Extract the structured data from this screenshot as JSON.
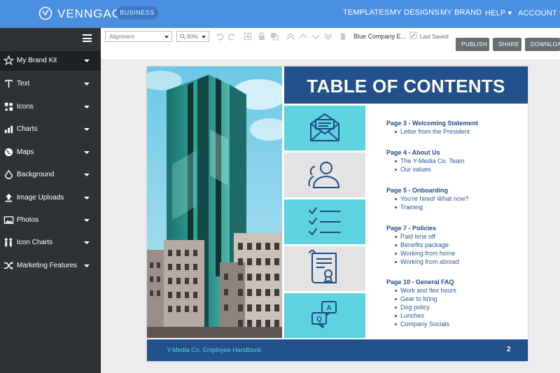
{
  "app": {
    "brand": "VENNGAGE",
    "plan_badge": "BUSINESS",
    "nav": [
      "TEMPLATES",
      "MY DESIGNS",
      "MY BRAND",
      "HELP ▾",
      "ACCOUNT ▾"
    ]
  },
  "sidebar": {
    "items": [
      {
        "label": "My Brand Kit",
        "icon": "star-icon"
      },
      {
        "label": "Text",
        "icon": "text-icon"
      },
      {
        "label": "Icons",
        "icon": "icons-grid-icon"
      },
      {
        "label": "Charts",
        "icon": "bar-chart-icon"
      },
      {
        "label": "Maps",
        "icon": "globe-icon"
      },
      {
        "label": "Background",
        "icon": "paint-bucket-icon"
      },
      {
        "label": "Image Uploads",
        "icon": "upload-icon"
      },
      {
        "label": "Photos",
        "icon": "photo-icon"
      },
      {
        "label": "Icon Charts",
        "icon": "people-chart-icon"
      },
      {
        "label": "Marketing Features",
        "icon": "shuffle-icon"
      }
    ]
  },
  "toolbar": {
    "alignment_value": "Alignment",
    "zoom_value": "80%",
    "document_name": "Blue Company E...",
    "last_saved_label": "Last Saved:",
    "publish_label": "PUBLISH",
    "share_label": "SHARE",
    "download_label": "DOWNLOAD"
  },
  "canvas": {
    "title": "TABLE OF CONTENTS",
    "sections": [
      {
        "heading": "Page 3 - Welcoming Statement",
        "items": [
          "Letter from the President"
        ]
      },
      {
        "heading": "Page 4 - About Us",
        "items": [
          "The Y-Media Co. Team",
          "Our values"
        ]
      },
      {
        "heading": "Page 5 - Onboarding",
        "items": [
          "You're hired! What now?",
          "Training"
        ]
      },
      {
        "heading": "Page 7 - Policies",
        "items": [
          "Paid time off",
          "Benefits package",
          "Working from home",
          "Working from abroad"
        ]
      },
      {
        "heading": "Page 10 - General FAQ",
        "items": [
          "Work and flex hours",
          "Gear to bring",
          "Dog policy",
          "Lunches",
          "Company Socials"
        ]
      }
    ],
    "faq_bubble_a": "A",
    "faq_bubble_q": "Q",
    "footer_text": "Y-Media Co. Employee Handbook",
    "page_number": "2"
  },
  "colors": {
    "topbar": "#4a8fe0",
    "sidebar": "#2e3235",
    "navy": "#22508a",
    "cyan": "#5dd3df",
    "grey_tile": "#e3e3e3"
  }
}
